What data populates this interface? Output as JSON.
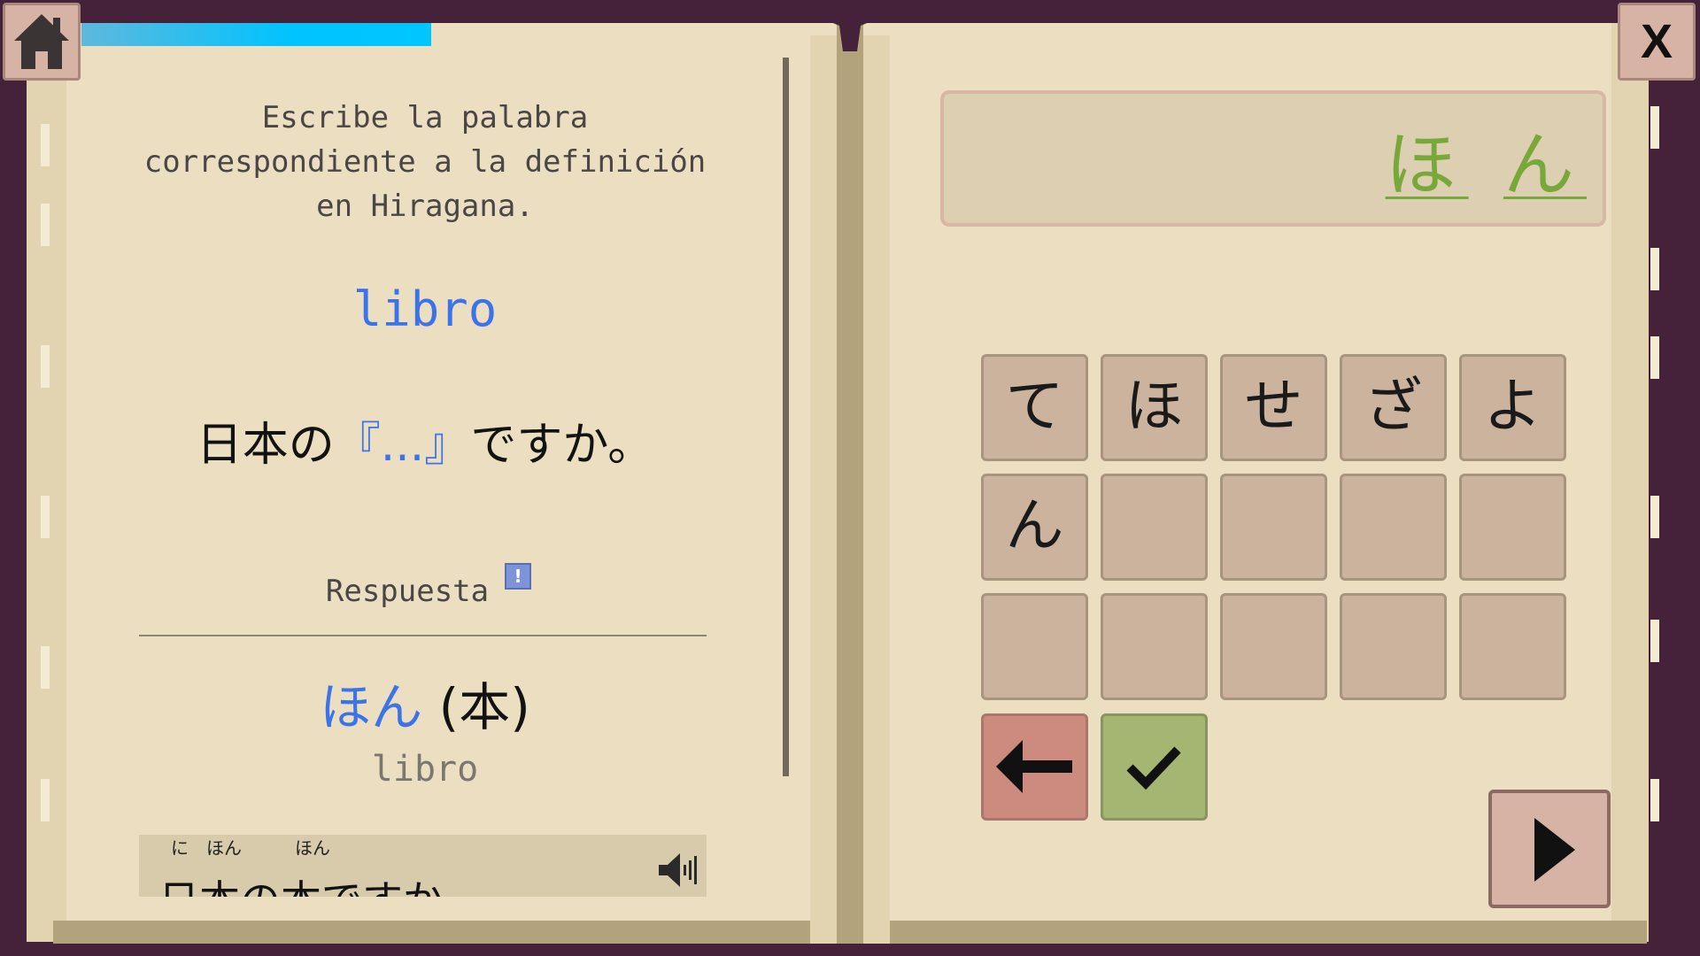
{
  "progress": {
    "fraction": 0.5
  },
  "home_button": {
    "icon": "home-icon"
  },
  "close_button": {
    "label": "X"
  },
  "left_page": {
    "instruction": "Escribe la palabra correspondiente a la definición en Hiragana.",
    "word": "libro",
    "sentence": {
      "before": "日本の",
      "blank": "『...』",
      "after": "ですか。"
    },
    "response_label": "Respuesta",
    "info_badge": "!",
    "answer": {
      "kana": "ほん",
      "kanji": "(本)"
    },
    "answer_meaning": "libro",
    "example": {
      "furigana": [
        "に",
        "ほん",
        "ほん"
      ],
      "text": "日本の本ですか。"
    }
  },
  "right_page": {
    "answer_field": [
      "ほ",
      "ん"
    ],
    "keys": [
      "て",
      "ほ",
      "せ",
      "ざ",
      "よ",
      "ん",
      "",
      "",
      "",
      "",
      "",
      "",
      "",
      "",
      ""
    ],
    "backspace_icon": "arrow-left-icon",
    "confirm_icon": "checkmark-icon",
    "next_icon": "play-triangle-icon"
  },
  "colors": {
    "accent_blue": "#3b73e8",
    "answer_green": "#78a83a",
    "page": "#ecdfc1",
    "frame": "#452239",
    "progress": "#00c3ff"
  }
}
